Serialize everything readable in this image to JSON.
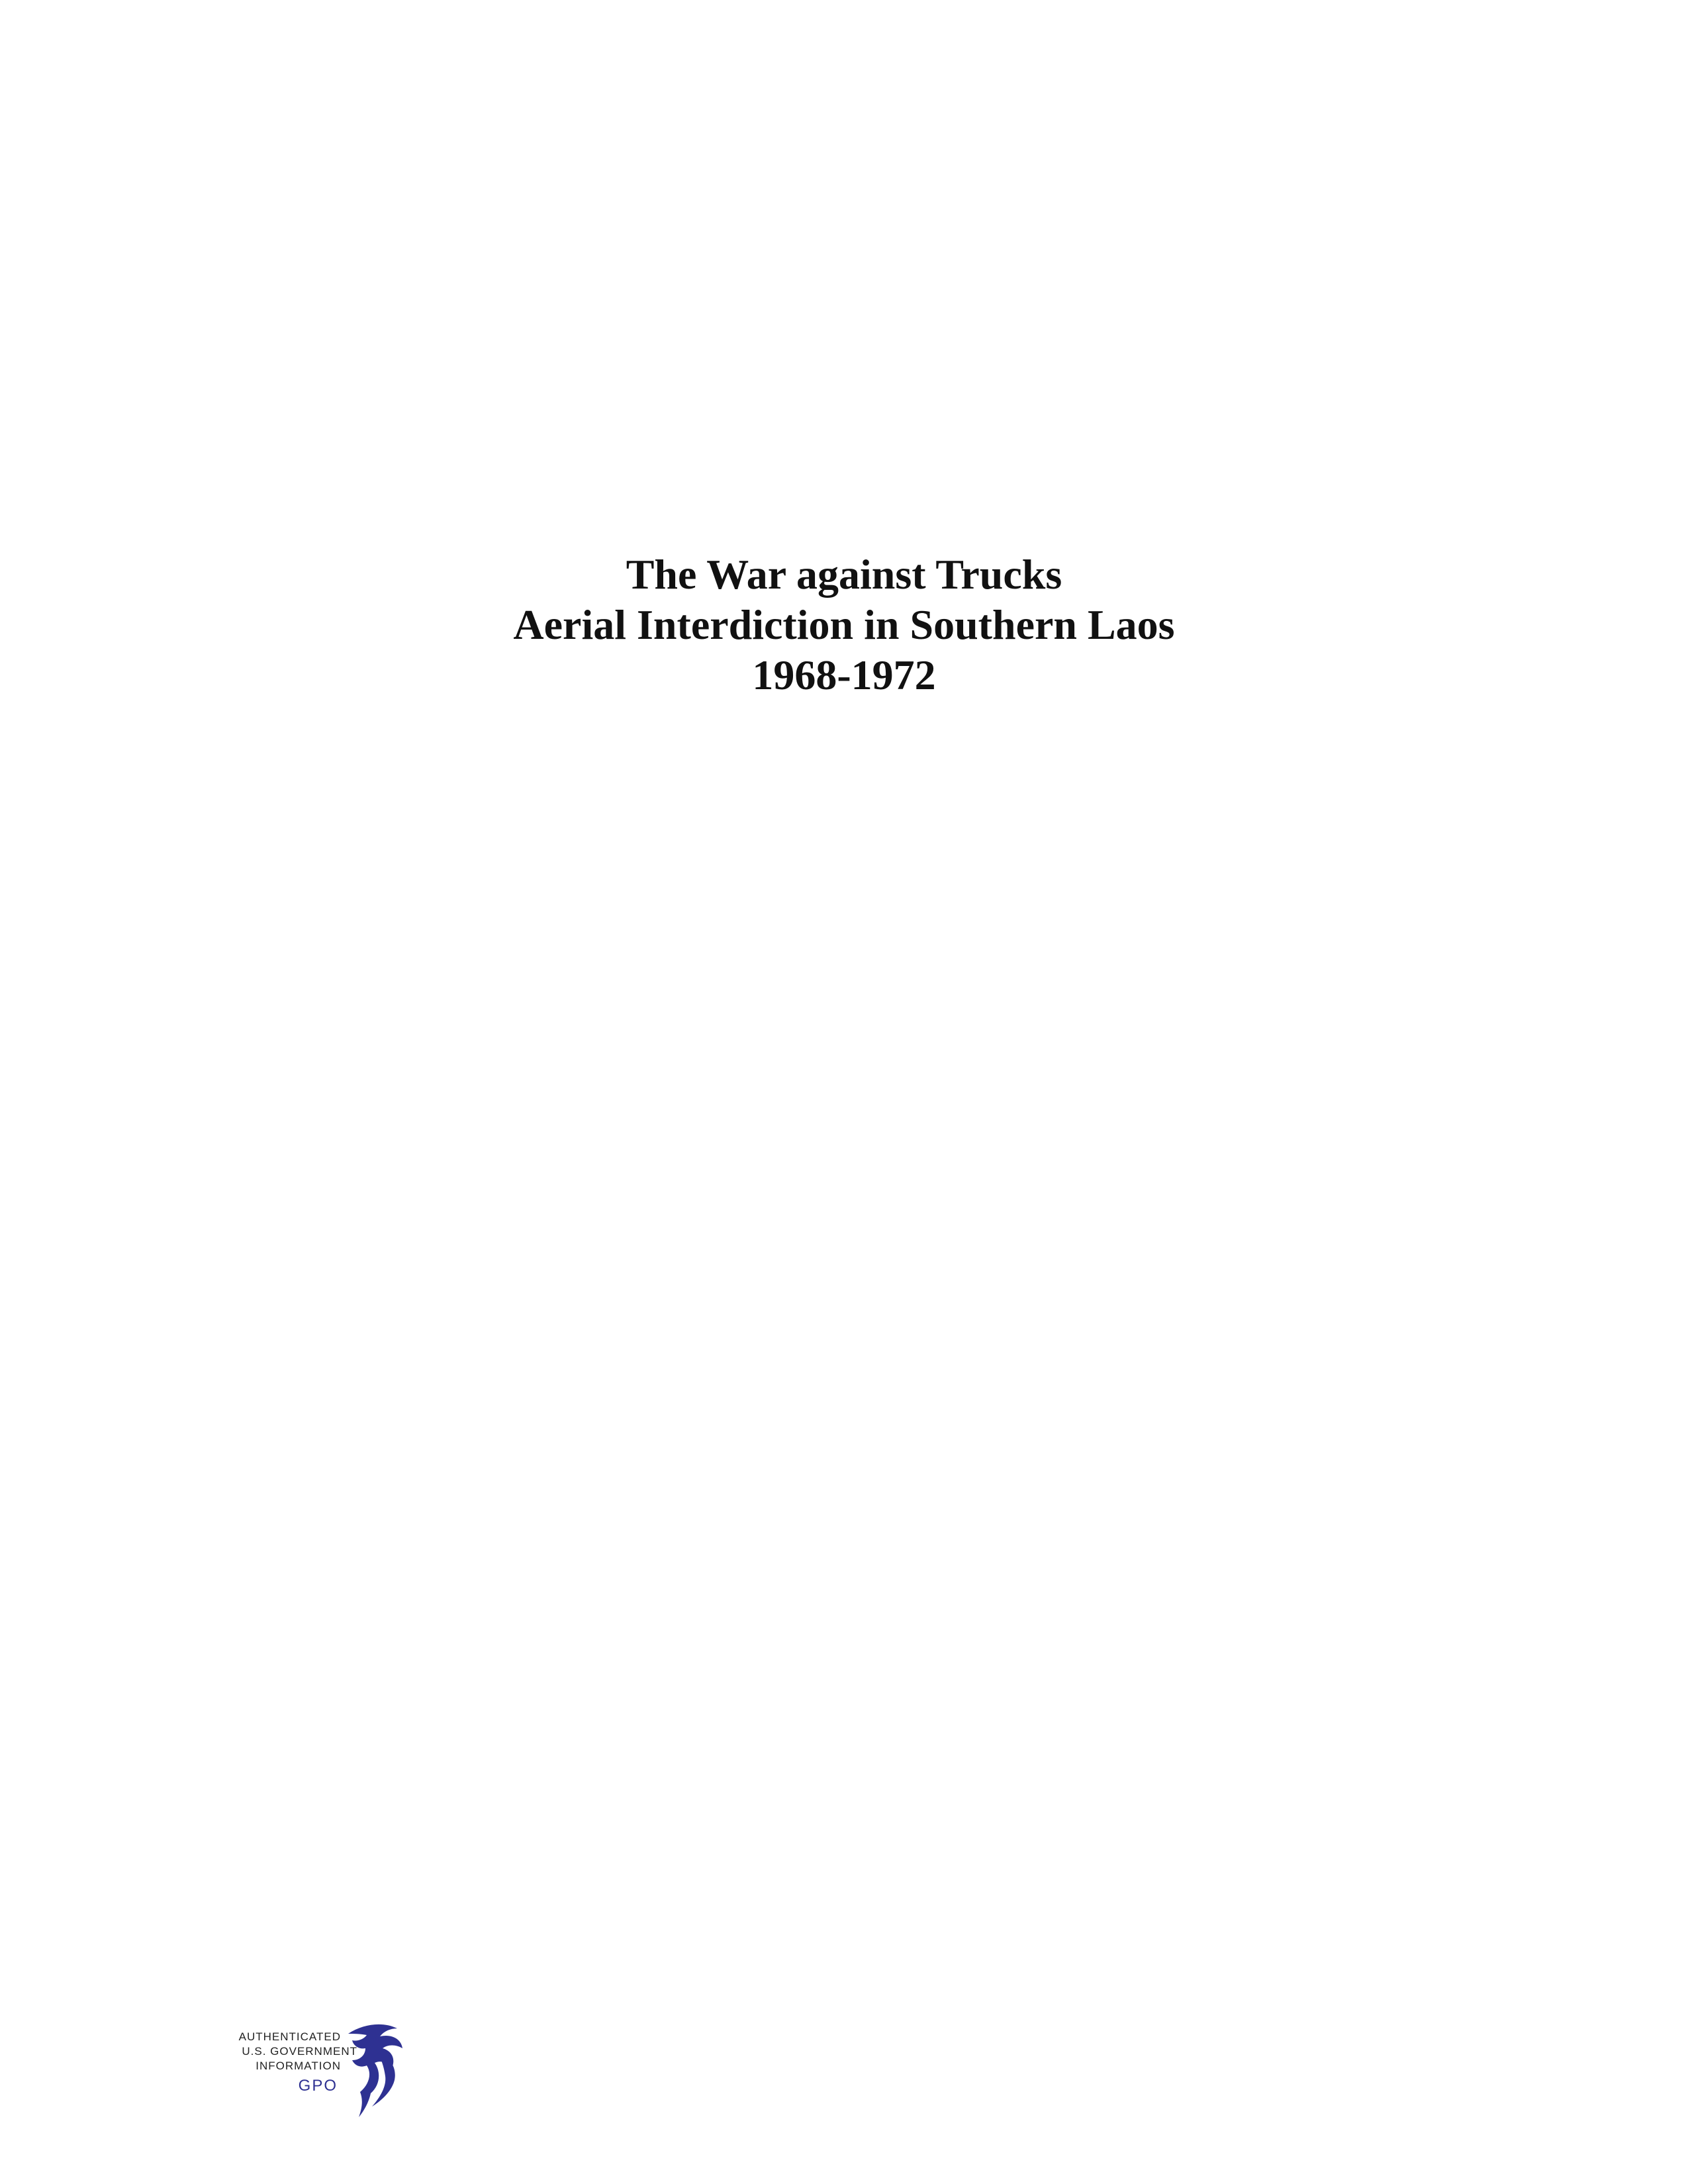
{
  "document": {
    "title_lines": [
      "The War against Trucks",
      "Aerial Interdiction in Southern Laos",
      "1968-1972"
    ]
  },
  "gpo_seal": {
    "line1": "AUTHENTICATED",
    "line2": "U.S. GOVERNMENT",
    "line3": "INFORMATION",
    "mark": "GPO",
    "color": "#2e3192",
    "icon": "eagle-icon"
  }
}
